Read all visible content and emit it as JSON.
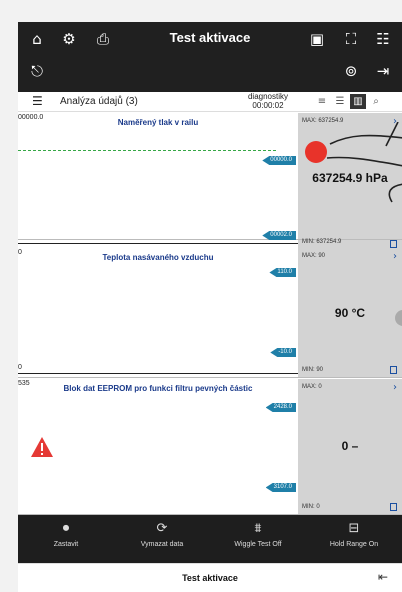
{
  "topbar": {
    "title": "Test aktivace",
    "icons": [
      "home-icon",
      "settings-icon",
      "camera-icon",
      "vci-icon",
      "fullscreen-icon",
      "menu-icon",
      "record-icon",
      "wifi-icon",
      "exit-icon"
    ]
  },
  "subbar": {
    "label": "Analýza údajů (3)",
    "diag_label": "diagnostiky",
    "diag_time": "00:00:02"
  },
  "panels": [
    {
      "title": "Naměřený tlak v railu",
      "y_top": "00000.0",
      "tag_top": "00000.0",
      "tag_bottom": "00002.0",
      "y_bottom": "0",
      "max": "MAX: 637254.9",
      "min": "MIN: 637254.9",
      "value": "637254.9 hPa"
    },
    {
      "title": "Teplota nasávaného vzduchu",
      "y_top": "0",
      "tag_top": "110.0",
      "tag_bottom": "-10.0",
      "y_bottom": "0",
      "max": "MAX: 90",
      "min": "MIN: 90",
      "value": "90 °C"
    },
    {
      "title": "Blok dat EEPROM pro funkci filtru pevných částic",
      "y_top": "535",
      "tag_top": "2428.0",
      "tag_bottom": "3107.0",
      "y_bottom": "",
      "max": "MAX: 0",
      "min": "MIN: 0",
      "value": "0 –"
    }
  ],
  "actions": [
    {
      "label": "Zastavit",
      "icon": "stop-icon"
    },
    {
      "label": "Vymazat data",
      "icon": "refresh-icon"
    },
    {
      "label": "Wiggle Test Off",
      "icon": "wiggle-icon"
    },
    {
      "label": "Hold Range On",
      "icon": "hold-range-icon"
    }
  ],
  "footer": {
    "title": "Test aktivace"
  },
  "colors": {
    "accent": "#1f7fa8",
    "touch_marker": "#e8332a",
    "warning": "#e53935",
    "graph_line": "#35a845"
  }
}
